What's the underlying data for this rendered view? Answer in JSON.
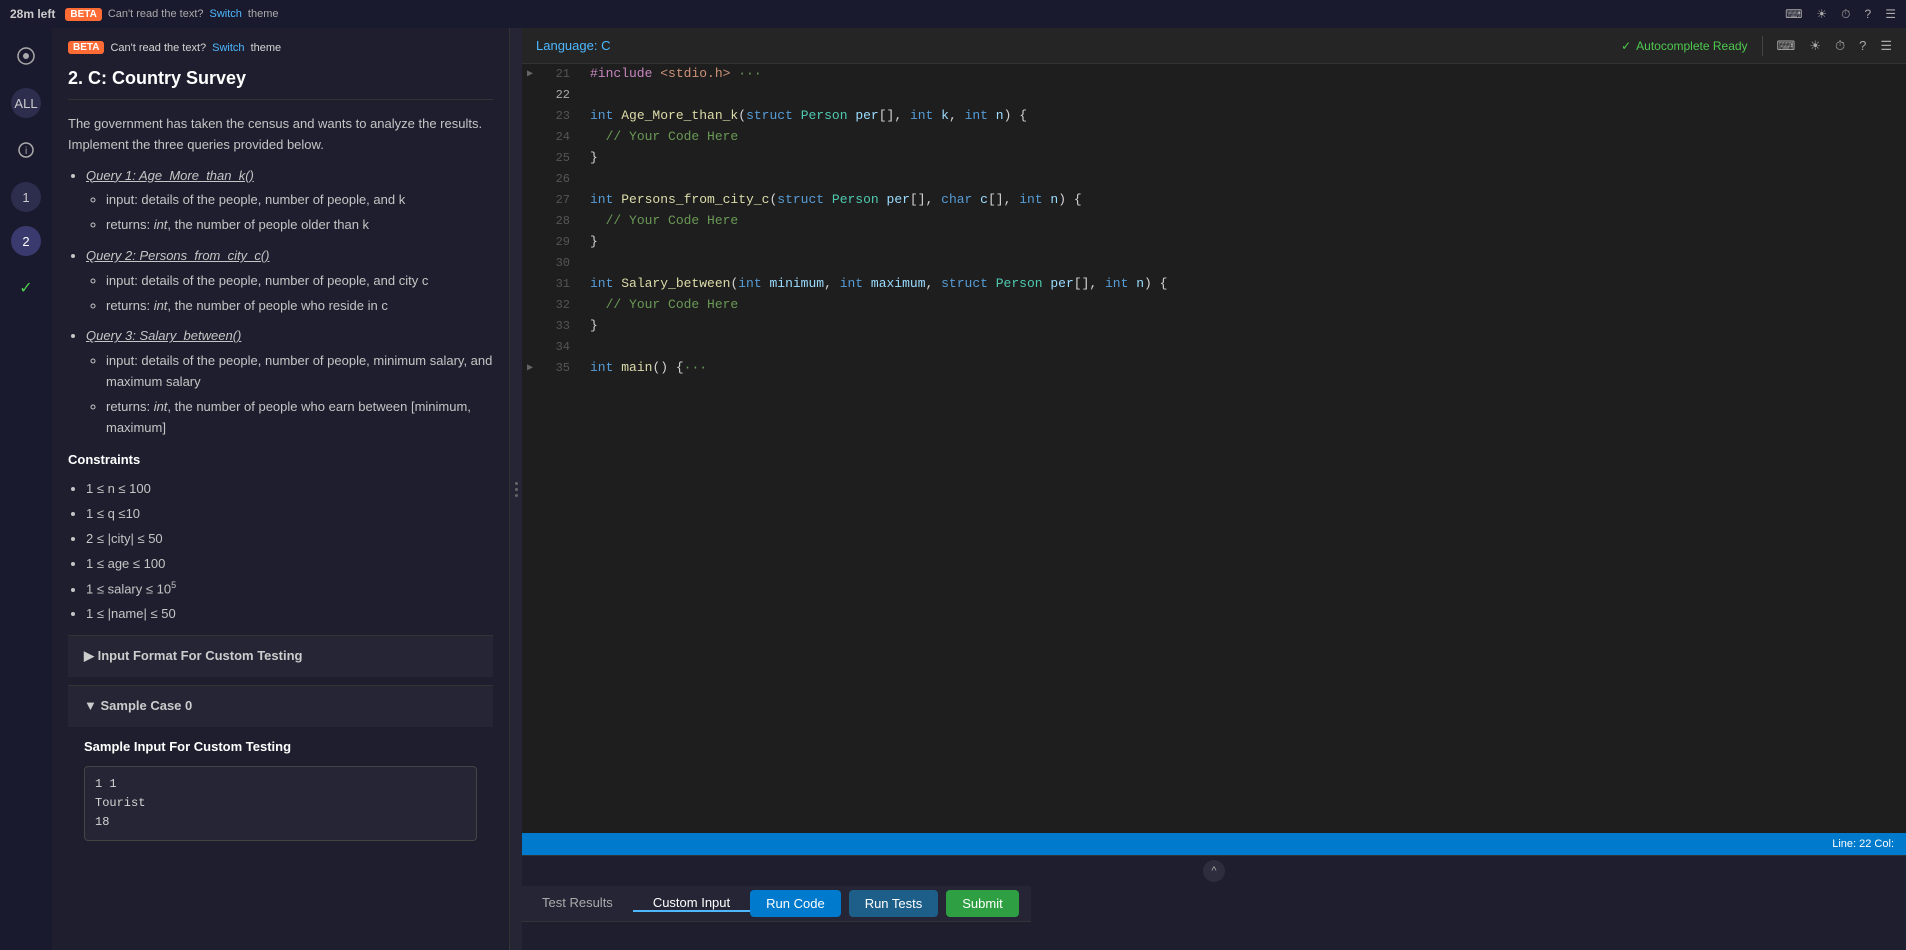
{
  "topbar": {
    "timer": "28m left",
    "beta_label": "BETA",
    "cant_read": "Can't read the text?",
    "switch": "Switch",
    "theme": "theme"
  },
  "sidebar": {
    "icons": [
      {
        "id": "all",
        "label": "ALL",
        "active": false
      },
      {
        "id": "info",
        "label": "ℹ",
        "active": false
      },
      {
        "id": "1",
        "label": "1",
        "active": false
      },
      {
        "id": "2",
        "label": "2",
        "active": true
      },
      {
        "id": "check",
        "label": "✓",
        "active": false
      }
    ]
  },
  "problem": {
    "title": "2. C: Country Survey",
    "description": "The government has taken the census and wants to analyze the results. Implement the three queries provided below.",
    "queries": [
      {
        "label": "Query 1: Age_More_than_k()",
        "bullets": [
          "input: details of the people, number of people, and k",
          "returns: int, the number of people older than k"
        ]
      },
      {
        "label": "Query 2: Persons_from_city_c()",
        "bullets": [
          "input: details of the people, number of people, and city c",
          "returns: int, the number of people who reside in c"
        ]
      },
      {
        "label": "Query 3: Salary_between()",
        "bullets": [
          "input: details of the people, number of people, minimum salary, and maximum salary",
          "returns: int, the number of people who earn between [minimum, maximum]"
        ]
      }
    ],
    "constraints_title": "Constraints",
    "constraints": [
      "1 ≤ n ≤ 100",
      "1 ≤ q ≤10",
      "2 ≤ |city| ≤ 50",
      "1 ≤ age ≤ 100",
      "1 ≤ salary ≤ 10⁵",
      "1 ≤ |name| ≤ 50"
    ],
    "input_format_section": {
      "label": "▶ Input Format For Custom Testing",
      "collapsed": true
    },
    "sample_case": {
      "label": "▼ Sample Case 0",
      "collapsed": false,
      "sample_input_label": "Sample Input For Custom Testing",
      "sample_input": "1 1\nTourist\n18"
    }
  },
  "editor": {
    "language": "Language: C",
    "info_icon": "ℹ",
    "autocomplete": "Autocomplete Ready",
    "keyboard_icon": "⌨",
    "sun_icon": "☀",
    "clock_icon": "⏱",
    "help_icon": "?",
    "menu_icon": "☰",
    "status": "Line: 22  Col:",
    "lines": [
      {
        "num": 21,
        "has_expand": true,
        "content": "<span class='macro'>#include</span> <span class='str'>&lt;stdio.h&gt;</span><span class='comment'> ···</span>"
      },
      {
        "num": 22,
        "has_expand": false,
        "content": ""
      },
      {
        "num": 23,
        "has_expand": false,
        "content": "<span class='kw'>int</span> <span class='fn'>Age_More_than_k</span><span class='punct'>(</span><span class='kw'>struct</span> <span class='type'>Person</span> <span class='param'>per</span><span class='punct'>[], </span><span class='kw'>int</span> <span class='param'>k</span><span class='punct'>, </span><span class='kw'>int</span> <span class='param'>n</span><span class='punct'>) {</span>"
      },
      {
        "num": 24,
        "has_expand": false,
        "content": "    <span class='comment'>// Your Code Here</span>"
      },
      {
        "num": 25,
        "has_expand": false,
        "content": "<span class='punct'>}</span>"
      },
      {
        "num": 26,
        "has_expand": false,
        "content": ""
      },
      {
        "num": 27,
        "has_expand": false,
        "content": "<span class='kw'>int</span> <span class='fn'>Persons_from_city_c</span><span class='punct'>(</span><span class='kw'>struct</span> <span class='type'>Person</span> <span class='param'>per</span><span class='punct'>[], </span><span class='kw'>char</span> <span class='param'>c</span><span class='punct'>[], </span><span class='kw'>int</span> <span class='param'>n</span><span class='punct'>) {</span>"
      },
      {
        "num": 28,
        "has_expand": false,
        "content": "    <span class='comment'>// Your Code Here</span>"
      },
      {
        "num": 29,
        "has_expand": false,
        "content": "<span class='punct'>}</span>"
      },
      {
        "num": 30,
        "has_expand": false,
        "content": ""
      },
      {
        "num": 31,
        "has_expand": false,
        "content": "<span class='kw'>int</span> <span class='fn'>Salary_between</span><span class='punct'>(</span><span class='kw'>int</span> <span class='param'>minimum</span><span class='punct'>, </span><span class='kw'>int</span> <span class='param'>maximum</span><span class='punct'>, </span><span class='kw'>struct</span> <span class='type'>Person</span> <span class='param'>per</span><span class='punct'>[], </span><span class='kw'>int</span> <span class='param'>n</span><span class='punct'>) {</span>"
      },
      {
        "num": 32,
        "has_expand": false,
        "content": "    <span class='comment'>// Your Code Here</span>"
      },
      {
        "num": 33,
        "has_expand": false,
        "content": "<span class='punct'>}</span>"
      },
      {
        "num": 34,
        "has_expand": false,
        "content": ""
      },
      {
        "num": 35,
        "has_expand": true,
        "content": "<span class='kw'>int</span> <span class='fn'>main</span><span class='punct'>() {</span><span class='comment'>···</span>"
      }
    ]
  },
  "bottom": {
    "tabs": [
      {
        "label": "Test Results",
        "active": false
      },
      {
        "label": "Custom Input",
        "active": true
      }
    ],
    "chevron_label": "^",
    "run_code": "Run Code",
    "run_tests": "Run Tests",
    "submit": "Submit"
  }
}
